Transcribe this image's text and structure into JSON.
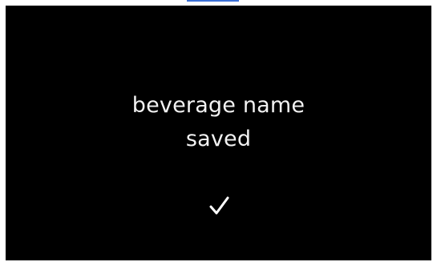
{
  "colors": {
    "screen_background": "#000000",
    "text": "#f2f2f2",
    "accent": "#3a6fd6"
  },
  "message": {
    "line1": "beverage name",
    "line2": "saved"
  },
  "icons": {
    "confirm": "checkmark-icon"
  }
}
